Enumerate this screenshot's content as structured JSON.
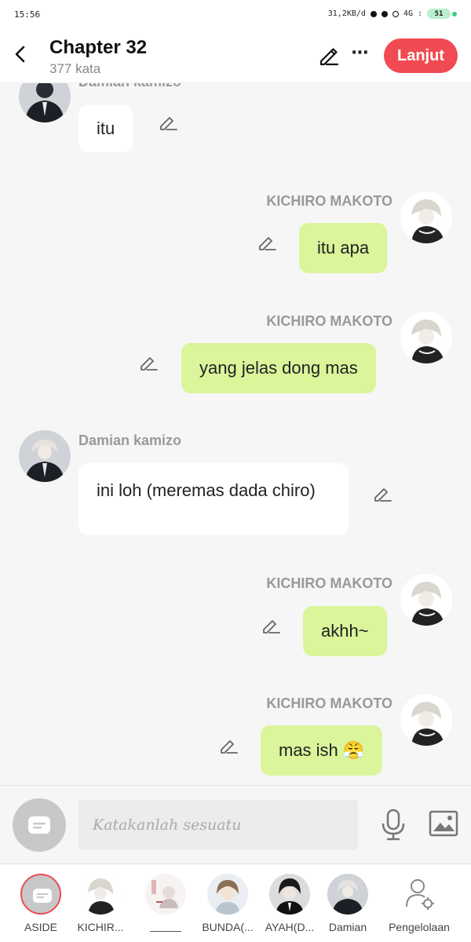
{
  "status_bar": {
    "time": "15:56",
    "net_speed": "31,2KB/d",
    "network": "4G",
    "battery": "51"
  },
  "header": {
    "title": "Chapter 32",
    "word_count": "377 kata",
    "next_button": "Lanjut"
  },
  "messages": [
    {
      "sender": "Damian kamizo",
      "side": "left",
      "text": "itu"
    },
    {
      "sender": "KICHIRO MAKOTO",
      "side": "right",
      "text": "itu apa"
    },
    {
      "sender": "KICHIRO MAKOTO",
      "side": "right",
      "text": "yang jelas dong mas"
    },
    {
      "sender": "Damian kamizo",
      "side": "left",
      "text": "ini loh (meremas dada chiro)"
    },
    {
      "sender": "KICHIRO MAKOTO",
      "side": "right",
      "text": "akhh~"
    },
    {
      "sender": "KICHIRO MAKOTO",
      "side": "right",
      "text": "mas ish 😤"
    }
  ],
  "composer": {
    "placeholder": "Katakanlah sesuatu"
  },
  "characters": [
    {
      "label": "ASIDE",
      "icon": "aside-icon",
      "active": true
    },
    {
      "label": "KICHIR...",
      "icon": "avatar-kichiro"
    },
    {
      "label": "",
      "icon": "avatar-sketch"
    },
    {
      "label": "BUNDA(...",
      "icon": "avatar-bunda"
    },
    {
      "label": "AYAH(D...",
      "icon": "avatar-ayah"
    },
    {
      "label": "Damian",
      "icon": "avatar-damian"
    },
    {
      "label": "Pengelolaan",
      "icon": "manage-icon"
    }
  ],
  "colors": {
    "accent": "#f04b52",
    "right_bubble": "#daf59a",
    "left_bubble": "#ffffff",
    "background": "#f6f6f6"
  }
}
